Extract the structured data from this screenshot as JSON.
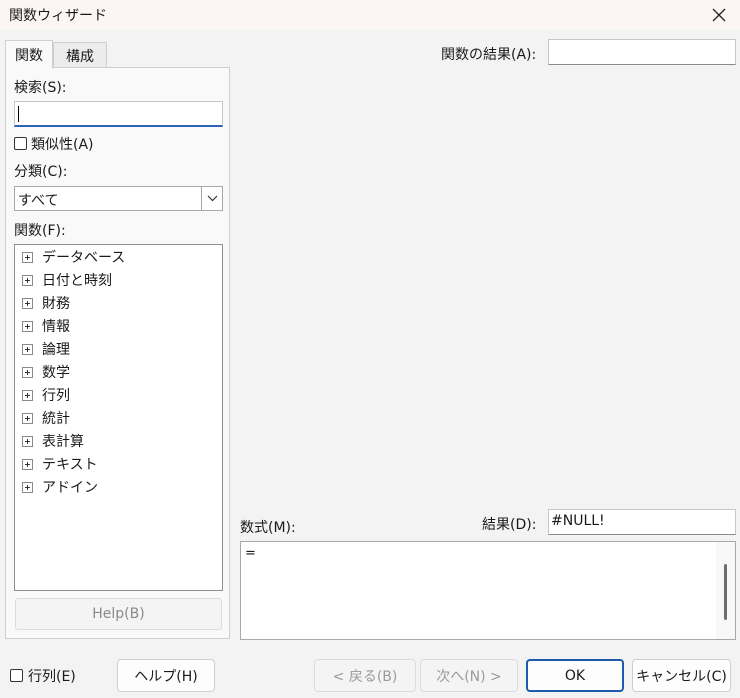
{
  "window": {
    "title": "関数ウィザード"
  },
  "tabs": [
    {
      "label": "関数",
      "active": true
    },
    {
      "label": "構成",
      "active": false
    }
  ],
  "search": {
    "label": "検索(S):",
    "value": ""
  },
  "similarity": {
    "label": "類似性(A)",
    "checked": false
  },
  "category": {
    "label": "分類(C):",
    "value": "すべて"
  },
  "functions": {
    "label": "関数(F):",
    "items": [
      "データベース",
      "日付と時刻",
      "財務",
      "情報",
      "論理",
      "数学",
      "行列",
      "統計",
      "表計算",
      "テキスト",
      "アドイン"
    ]
  },
  "help_inner": {
    "label": "Help(B)"
  },
  "function_result": {
    "label": "関数の結果(A):",
    "value": ""
  },
  "formula": {
    "label": "数式(M):",
    "value": "="
  },
  "result": {
    "label": "結果(D):",
    "value": "#NULL!"
  },
  "matrix": {
    "label": "行列(E)",
    "checked": false
  },
  "buttons": {
    "help": "ヘルプ(H)",
    "back": "< 戻る(B)",
    "next": "次へ(N) >",
    "ok": "OK",
    "cancel": "キャンセル(C)"
  },
  "colors": {
    "accent": "#1e5aa8",
    "titlebar": "#fbf5f4"
  },
  "icons": {
    "close": "close-icon",
    "dropdown": "chevron-down-icon",
    "expander": "plus-box-icon"
  }
}
